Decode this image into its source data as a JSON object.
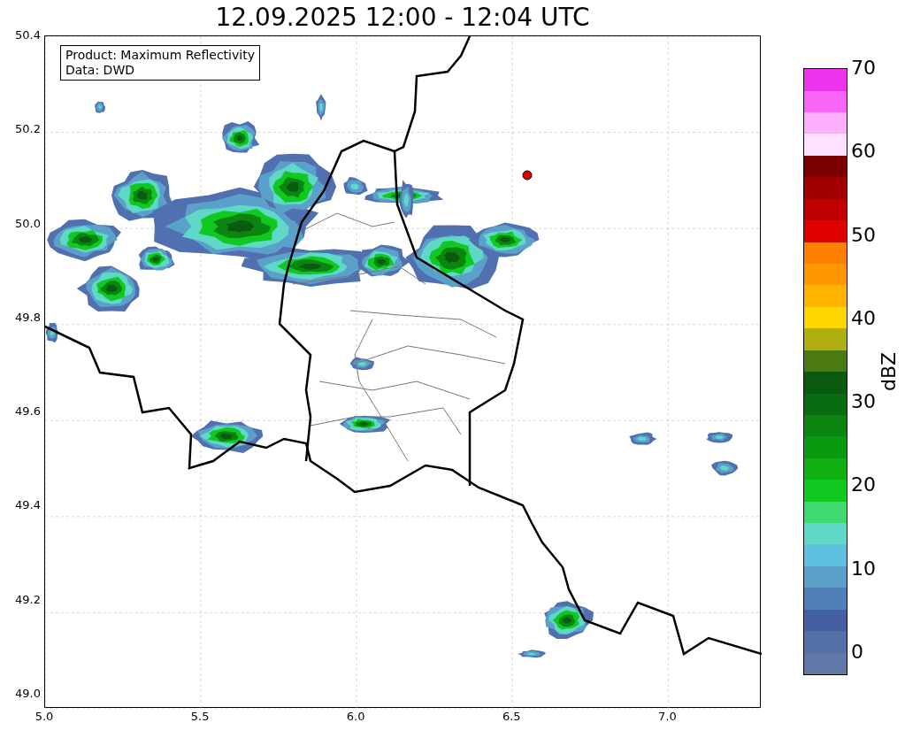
{
  "title": "12.09.2025 12:00 - 12:04 UTC",
  "map": {
    "yticks": [
      "50.4",
      "50.2",
      "50.0",
      "49.8",
      "49.6",
      "49.4",
      "49.2",
      "49.0"
    ],
    "xticks": [
      "5.0",
      "5.5",
      "6.0",
      "6.5",
      "7.0"
    ],
    "info_box": {
      "lines": [
        "Product: Maximum Reflectivity",
        "Data: DWD"
      ]
    }
  },
  "colorbar": {
    "label": "dBZ",
    "ticks": [
      "70",
      "60",
      "50",
      "40",
      "30",
      "20",
      "10",
      "0"
    ],
    "bands": [
      {
        "color": "#6078a8"
      },
      {
        "color": "#5570a8"
      },
      {
        "color": "#4460a0"
      },
      {
        "color": "#5080b8"
      },
      {
        "color": "#5aa0c8"
      },
      {
        "color": "#60c0e0"
      },
      {
        "color": "#60d8c8"
      },
      {
        "color": "#40d870"
      },
      {
        "color": "#10c820"
      },
      {
        "color": "#10b010"
      },
      {
        "color": "#0a9a10"
      },
      {
        "color": "#0a8510"
      },
      {
        "color": "#0a6c10"
      },
      {
        "color": "#0a5a10"
      },
      {
        "color": "#4a7a10"
      },
      {
        "color": "#afaf10"
      },
      {
        "color": "#ffd700"
      },
      {
        "color": "#ffb400"
      },
      {
        "color": "#ff9800"
      },
      {
        "color": "#ff7f00"
      },
      {
        "color": "#e00000"
      },
      {
        "color": "#c00000"
      },
      {
        "color": "#a00000"
      },
      {
        "color": "#7a0000"
      },
      {
        "color": "#ffe0ff"
      },
      {
        "color": "#fcb0fc"
      },
      {
        "color": "#f866f8"
      },
      {
        "color": "#ee33ee"
      }
    ]
  }
}
